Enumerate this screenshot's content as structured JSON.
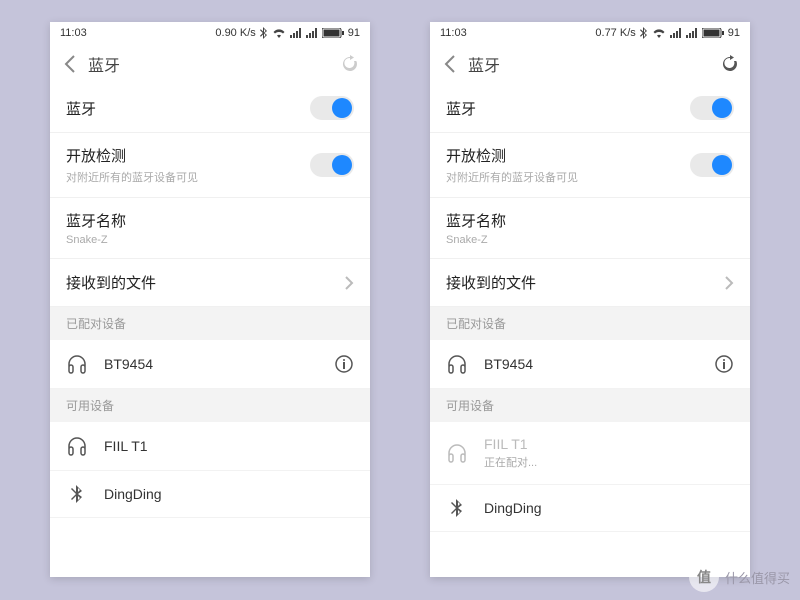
{
  "watermark": {
    "text": "什么值得买",
    "badge": "值"
  },
  "left": {
    "status": {
      "time": "11:03",
      "speed": "0.90 K/s",
      "battery": "91"
    },
    "nav": {
      "title": "蓝牙"
    },
    "rows": {
      "bluetooth": {
        "label": "蓝牙",
        "on": true
      },
      "discover": {
        "label": "开放检测",
        "sub": "对附近所有的蓝牙设备可见",
        "on": true
      },
      "name": {
        "label": "蓝牙名称",
        "value": "Snake-Z"
      },
      "files": {
        "label": "接收到的文件"
      }
    },
    "sections": {
      "paired_hdr": "已配对设备",
      "paired": [
        {
          "name": "BT9454",
          "icon": "headphones",
          "info": true
        }
      ],
      "available_hdr": "可用设备",
      "available": [
        {
          "name": "FIIL T1",
          "icon": "headphones"
        },
        {
          "name": "DingDing",
          "icon": "bluetooth"
        }
      ]
    }
  },
  "right": {
    "status": {
      "time": "11:03",
      "speed": "0.77 K/s",
      "battery": "91"
    },
    "nav": {
      "title": "蓝牙"
    },
    "rows": {
      "bluetooth": {
        "label": "蓝牙",
        "on": true
      },
      "discover": {
        "label": "开放检测",
        "sub": "对附近所有的蓝牙设备可见",
        "on": true
      },
      "name": {
        "label": "蓝牙名称",
        "value": "Snake-Z"
      },
      "files": {
        "label": "接收到的文件"
      }
    },
    "sections": {
      "paired_hdr": "已配对设备",
      "paired": [
        {
          "name": "BT9454",
          "icon": "headphones",
          "info": true
        }
      ],
      "available_hdr": "可用设备",
      "available": [
        {
          "name": "FIIL T1",
          "icon": "headphones",
          "status": "正在配对...",
          "faded": true
        },
        {
          "name": "DingDing",
          "icon": "bluetooth"
        }
      ]
    }
  }
}
